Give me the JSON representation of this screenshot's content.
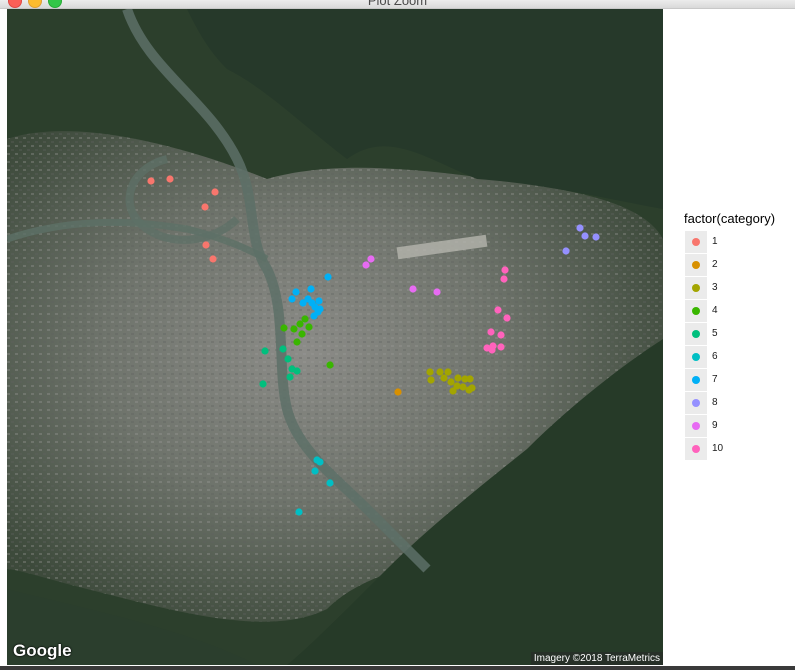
{
  "window": {
    "title": "Plot Zoom",
    "colors": {
      "close": "#fc5f57",
      "minimize": "#fdbc2e",
      "maximize": "#33c748"
    }
  },
  "map": {
    "logo_text": "Google",
    "attribution": "Imagery ©2018 TerraMetrics"
  },
  "chart_data": {
    "type": "scatter",
    "title": "",
    "xlabel": "",
    "ylabel": "",
    "grid": false,
    "legend_placement": "right",
    "legend_title": "factor(category)",
    "background": "satellite imagery",
    "series": [
      {
        "name": "1",
        "color": "#F8766D",
        "points": [
          [
            144,
            172
          ],
          [
            163,
            170
          ],
          [
            208,
            183
          ],
          [
            198,
            198
          ],
          [
            199,
            236
          ],
          [
            206,
            250
          ]
        ]
      },
      {
        "name": "2",
        "color": "#D89000",
        "points": [
          [
            391,
            383
          ]
        ]
      },
      {
        "name": "3",
        "color": "#A3A500",
        "points": [
          [
            423,
            363
          ],
          [
            433,
            363
          ],
          [
            441,
            363
          ],
          [
            424,
            371
          ],
          [
            437,
            369
          ],
          [
            444,
            373
          ],
          [
            451,
            369
          ],
          [
            458,
            370
          ],
          [
            463,
            370
          ],
          [
            450,
            377
          ],
          [
            456,
            378
          ],
          [
            465,
            379
          ],
          [
            462,
            381
          ],
          [
            446,
            382
          ]
        ]
      },
      {
        "name": "4",
        "color": "#39B600",
        "points": [
          [
            298,
            310
          ],
          [
            293,
            315
          ],
          [
            302,
            318
          ],
          [
            287,
            320
          ],
          [
            295,
            325
          ],
          [
            290,
            333
          ],
          [
            277,
            319
          ],
          [
            323,
            356
          ]
        ]
      },
      {
        "name": "5",
        "color": "#00BF7D",
        "points": [
          [
            276,
            340
          ],
          [
            281,
            350
          ],
          [
            285,
            360
          ],
          [
            258,
            342
          ],
          [
            290,
            362
          ],
          [
            283,
            368
          ],
          [
            256,
            375
          ]
        ]
      },
      {
        "name": "6",
        "color": "#00BFC4",
        "points": [
          [
            310,
            451
          ],
          [
            308,
            462
          ],
          [
            313,
            453
          ],
          [
            323,
            474
          ],
          [
            292,
            503
          ]
        ]
      },
      {
        "name": "7",
        "color": "#00B0F6",
        "points": [
          [
            321,
            268
          ],
          [
            289,
            283
          ],
          [
            304,
            280
          ],
          [
            285,
            290
          ],
          [
            301,
            290
          ],
          [
            296,
            294
          ],
          [
            305,
            294
          ],
          [
            312,
            292
          ],
          [
            308,
            298
          ],
          [
            311,
            303
          ],
          [
            313,
            300
          ],
          [
            307,
            307
          ]
        ]
      },
      {
        "name": "8",
        "color": "#9590FF",
        "points": [
          [
            573,
            219
          ],
          [
            578,
            227
          ],
          [
            589,
            228
          ],
          [
            559,
            242
          ]
        ]
      },
      {
        "name": "9",
        "color": "#E76BF3",
        "points": [
          [
            364,
            250
          ],
          [
            359,
            256
          ],
          [
            406,
            280
          ],
          [
            430,
            283
          ]
        ]
      },
      {
        "name": "10",
        "color": "#FF62BC",
        "points": [
          [
            498,
            261
          ],
          [
            497,
            270
          ],
          [
            491,
            301
          ],
          [
            500,
            309
          ],
          [
            484,
            323
          ],
          [
            494,
            326
          ],
          [
            486,
            337
          ],
          [
            494,
            338
          ],
          [
            485,
            341
          ],
          [
            480,
            339
          ]
        ]
      }
    ]
  },
  "legend": {
    "title": "factor(category)",
    "items": [
      {
        "label": "1",
        "color": "#F8766D"
      },
      {
        "label": "2",
        "color": "#D89000"
      },
      {
        "label": "3",
        "color": "#A3A500"
      },
      {
        "label": "4",
        "color": "#39B600"
      },
      {
        "label": "5",
        "color": "#00BF7D"
      },
      {
        "label": "6",
        "color": "#00BFC4"
      },
      {
        "label": "7",
        "color": "#00B0F6"
      },
      {
        "label": "8",
        "color": "#9590FF"
      },
      {
        "label": "9",
        "color": "#E76BF3"
      },
      {
        "label": "10",
        "color": "#FF62BC"
      }
    ]
  }
}
